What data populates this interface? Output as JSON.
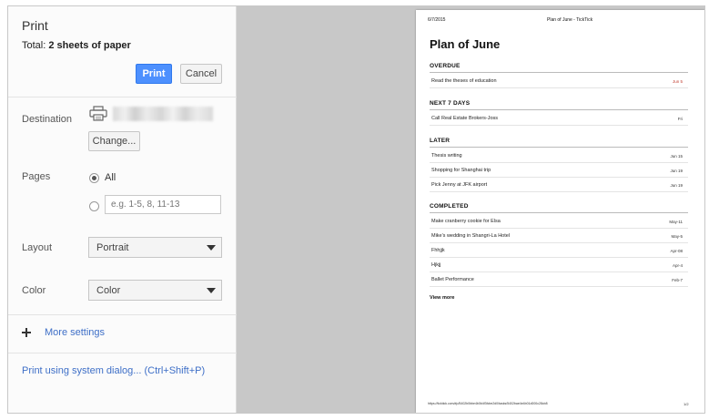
{
  "dialog": {
    "title": "Print",
    "total_prefix": "Total: ",
    "total_value": "2 sheets of paper",
    "print_label": "Print",
    "cancel_label": "Cancel"
  },
  "destination": {
    "label": "Destination",
    "change_label": "Change..."
  },
  "pages": {
    "label": "Pages",
    "all_label": "All",
    "custom_placeholder": "e.g. 1-5, 8, 11-13"
  },
  "layout": {
    "label": "Layout",
    "value": "Portrait"
  },
  "color": {
    "label": "Color",
    "value": "Color"
  },
  "more_settings": "More settings",
  "system_dialog": "Print using system dialog... (Ctrl+Shift+P)",
  "preview": {
    "header_date": "6/7/2015",
    "header_title": "Plan of June - TickTick",
    "doc_title": "Plan of June",
    "sections": [
      {
        "name": "OVERDUE",
        "tasks": [
          {
            "title": "Read the theses of education",
            "due": "Jun 5"
          }
        ]
      },
      {
        "name": "NEXT 7 DAYS",
        "tasks": [
          {
            "title": "Call Real Estate Brokers-Joss",
            "due": "Fri"
          }
        ]
      },
      {
        "name": "LATER",
        "tasks": [
          {
            "title": "Thesis writing",
            "due": "Jun 15"
          },
          {
            "title": "Shopping for Shanghai trip",
            "due": "Jun 19"
          },
          {
            "title": "Pick Jenny at JFK airport",
            "due": "Jun 19"
          }
        ]
      },
      {
        "name": "COMPLETED",
        "tasks": [
          {
            "title": "Make cranberry cookie for Elsa",
            "due": "May-11"
          },
          {
            "title": "Mike's wedding in Shangri-La Hotel",
            "due": "May-5"
          },
          {
            "title": "Fhhjjk",
            "due": "Apr-08"
          },
          {
            "title": "Hjkjj",
            "due": "Apr-4"
          },
          {
            "title": "Ballet Performance",
            "due": "Feb-7"
          }
        ]
      }
    ],
    "view_more": "View more",
    "footer_url": "https://ticktick.com/#p/5402b0bbe4b0b4f3fcbe2d0/tasks/5402bae4e4b01d000c28cb8",
    "footer_page": "1/2",
    "overdue_color": "#c0392b"
  }
}
